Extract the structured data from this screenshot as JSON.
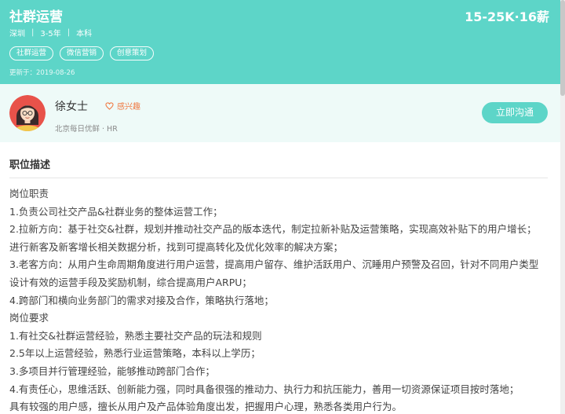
{
  "job": {
    "title": "社群运营",
    "salary": "15-25K·16薪",
    "city": "深圳",
    "experience": "3-5年",
    "education": "本科",
    "tags": [
      "社群运营",
      "微信营销",
      "创意策划"
    ],
    "update_time": "更新于：2019-08-26"
  },
  "recruiter": {
    "name": "徐女士",
    "interest_label": "感兴趣",
    "company": "北京每日优鲜 · HR",
    "chat_button": "立即沟通",
    "avatar_icon": "female-avatar-icon",
    "interest_icon": "heart-outline-icon"
  },
  "description": {
    "section_title": "职位描述",
    "lines": [
      "岗位职责",
      "1.负责公司社交产品&社群业务的整体运营工作；",
      "2.拉新方向：基于社交&社群，规划并推动社交产品的版本迭代，制定拉新补贴及运营策略，实现高效补贴下的用户增长；",
      "进行新客及新客增长相关数据分析，找到可提高转化及优化效率的解决方案；",
      "3.老客方向：从用户生命周期角度进行用户运营，提高用户留存、维护活跃用户、沉睡用户预警及召回，针对不同用户类型",
      "设计有效的运营手段及奖励机制，综合提高用户ARPU；",
      "4.跨部门和横向业务部门的需求对接及合作，策略执行落地；",
      "岗位要求",
      "1.有社交&社群运营经验，熟悉主要社交产品的玩法和规则",
      "2.5年以上运营经验，熟悉行业运营策略，本科以上学历；",
      "3.多项目并行管理经验，能够推动跨部门合作；",
      "4.有责任心，思维活跃、创新能力强，同时具备很强的推动力、执行力和抗压能力，善用一切资源保证项目按时落地；",
      "具有较强的用户感，擅长从用户及产品体验角度出发，把握用户心理，熟悉各类用户行为。"
    ]
  },
  "colors": {
    "brand": "#5dd5c8",
    "interest": "#f07a43",
    "recruiter_bg": "#eefaf8"
  }
}
